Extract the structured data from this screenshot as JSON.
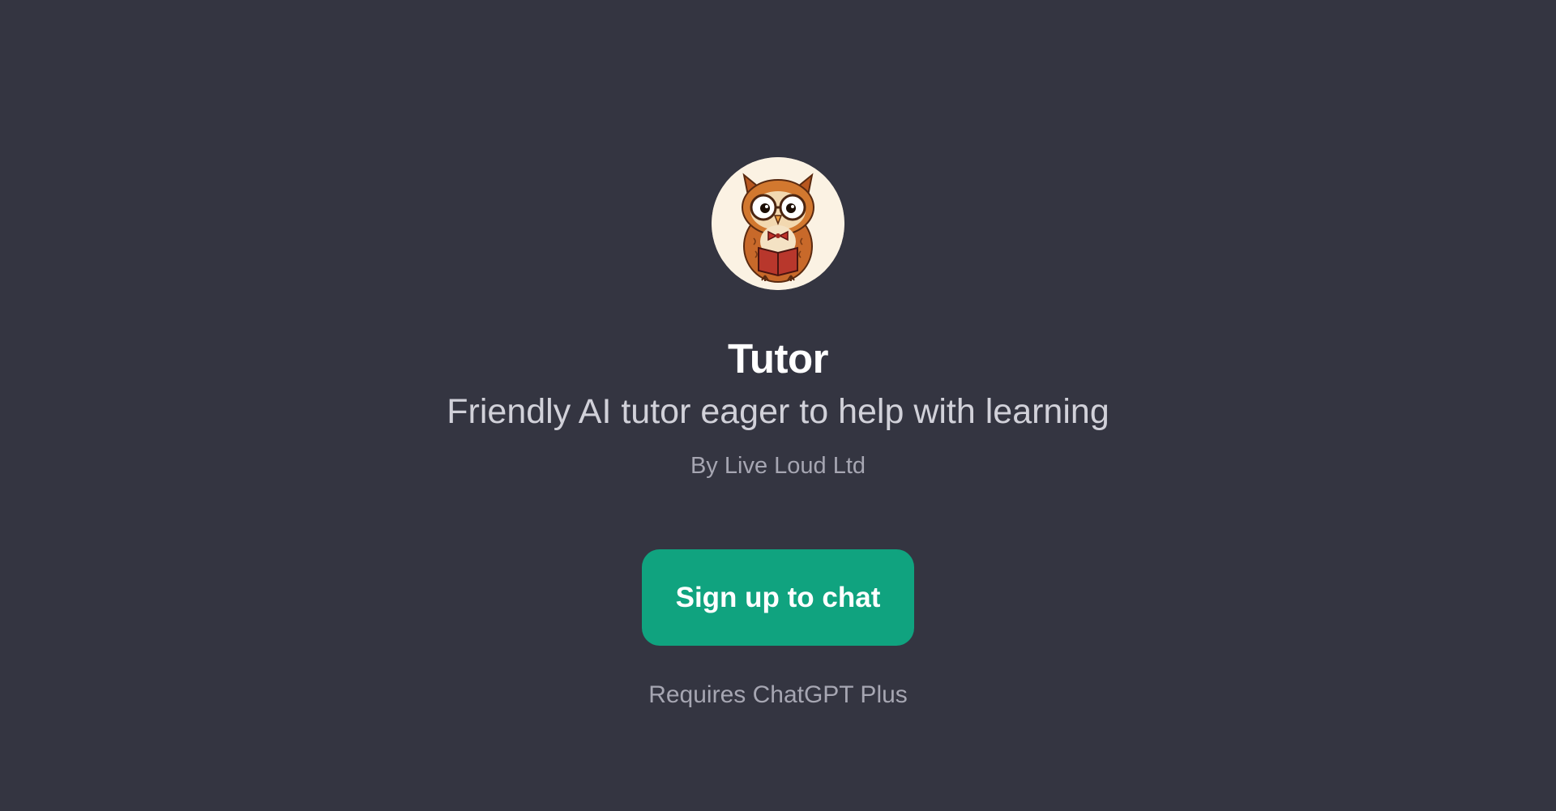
{
  "gpt": {
    "name": "Tutor",
    "description": "Friendly AI tutor eager to help with learning",
    "author": "By Live Loud Ltd",
    "avatar_icon": "owl-with-glasses-reading-book"
  },
  "actions": {
    "signup_label": "Sign up to chat"
  },
  "footer": {
    "requirement": "Requires ChatGPT Plus"
  },
  "colors": {
    "background": "#343541",
    "accent": "#10a37f",
    "title": "#ffffff",
    "muted": "#a6a6b2"
  }
}
